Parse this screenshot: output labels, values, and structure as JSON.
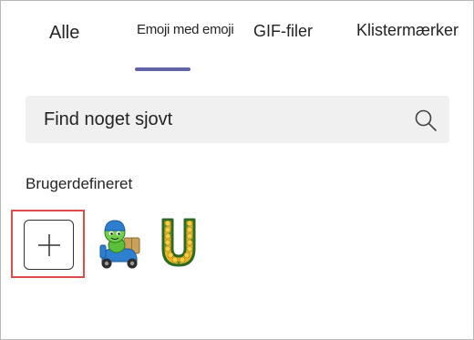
{
  "tabs": [
    {
      "label": "Alle"
    },
    {
      "label": "Emoji med emoji"
    },
    {
      "label": "GIF-filer"
    },
    {
      "label": "Klistermærker"
    }
  ],
  "active_tab": "Emoji med emoji",
  "accent_color": "#6264a7",
  "highlight_color": "#e04a4a",
  "search": {
    "placeholder": "Find noget sjovt",
    "value": "",
    "icon": "search-icon"
  },
  "section": {
    "title": "Brugerdefineret"
  },
  "custom_items": [
    {
      "icon": "plus-icon"
    },
    {
      "icon": "green-character-scooter-emoji"
    },
    {
      "icon": "flower-letter-u-emoji"
    }
  ]
}
